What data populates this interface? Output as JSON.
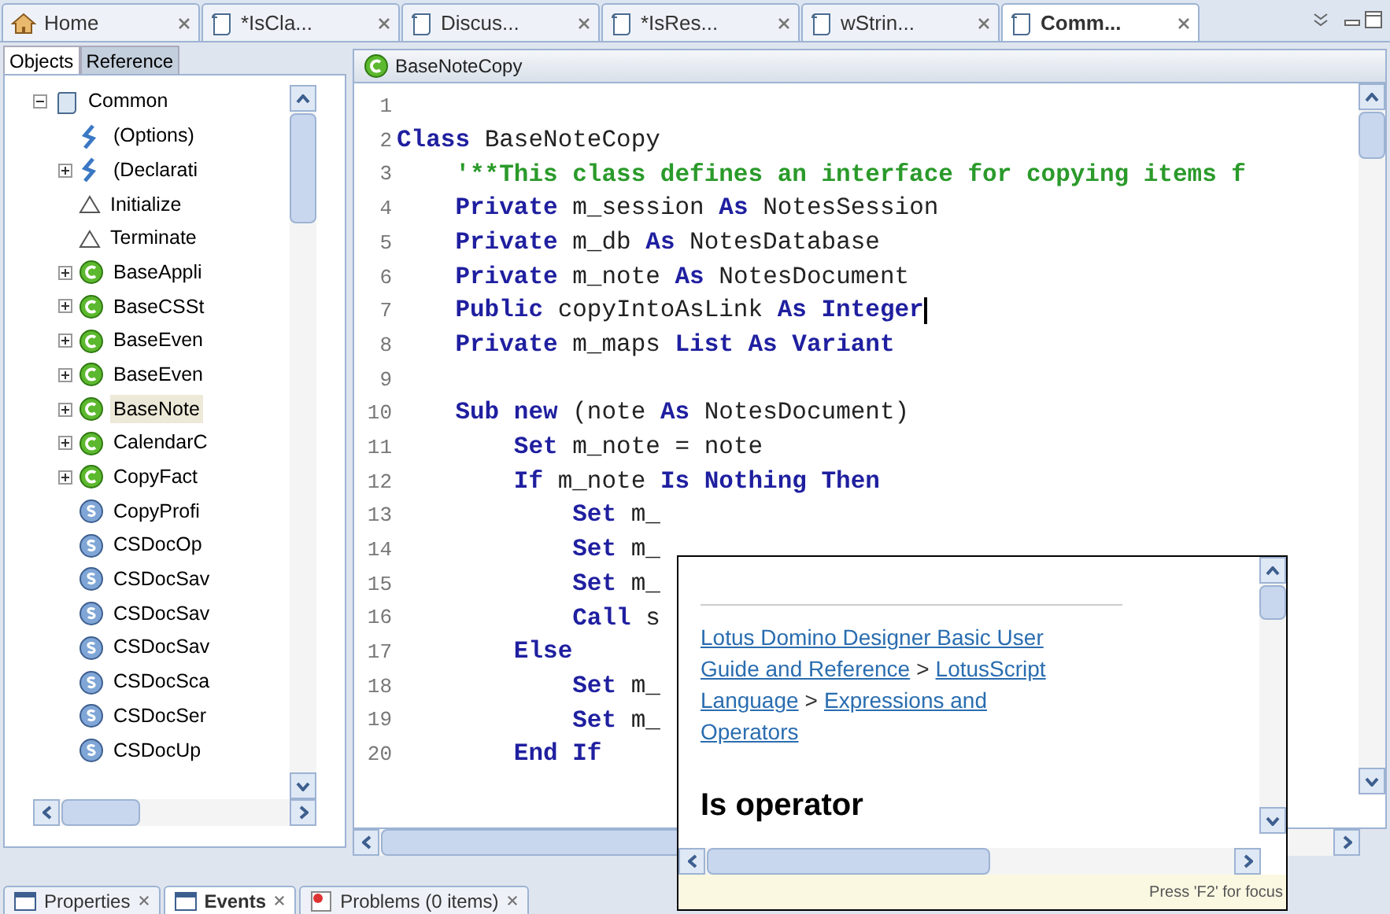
{
  "editor_tabs": [
    {
      "label": "Home",
      "kind": "home",
      "selected": false
    },
    {
      "label": "*IsCla...",
      "kind": "doc",
      "selected": false
    },
    {
      "label": "Discus...",
      "kind": "doc",
      "selected": false
    },
    {
      "label": "*IsRes...",
      "kind": "doc",
      "selected": false
    },
    {
      "label": "wStrin...",
      "kind": "doc",
      "selected": false
    },
    {
      "label": "Comm...",
      "kind": "doc",
      "selected": true
    }
  ],
  "side_tabs": [
    {
      "label": "Objects",
      "selected": true
    },
    {
      "label": "Reference",
      "selected": false
    }
  ],
  "tree": [
    {
      "label": "Common",
      "kind": "library",
      "expanded": true,
      "selected": false,
      "children": [
        {
          "label": "(Options)",
          "kind": "script",
          "selected": false
        },
        {
          "label": "(Declarati",
          "kind": "script",
          "expanded": false,
          "selected": false
        },
        {
          "label": "Initialize",
          "kind": "event",
          "selected": false
        },
        {
          "label": "Terminate",
          "kind": "event",
          "selected": false
        },
        {
          "label": "BaseAppli",
          "kind": "class",
          "expanded": false,
          "selected": false
        },
        {
          "label": "BaseCSSt",
          "kind": "class",
          "expanded": false,
          "selected": false
        },
        {
          "label": "BaseEven",
          "kind": "class",
          "expanded": false,
          "selected": false
        },
        {
          "label": "BaseEven",
          "kind": "class",
          "expanded": false,
          "selected": false
        },
        {
          "label": "BaseNote",
          "kind": "class",
          "expanded": false,
          "selected": true
        },
        {
          "label": "CalendarC",
          "kind": "class",
          "expanded": false,
          "selected": false
        },
        {
          "label": "CopyFact",
          "kind": "class",
          "expanded": false,
          "selected": false
        },
        {
          "label": "CopyProfi",
          "kind": "sub",
          "selected": false
        },
        {
          "label": "CSDocOp",
          "kind": "sub",
          "selected": false
        },
        {
          "label": "CSDocSav",
          "kind": "sub",
          "selected": false
        },
        {
          "label": "CSDocSav",
          "kind": "sub",
          "selected": false
        },
        {
          "label": "CSDocSav",
          "kind": "sub",
          "selected": false
        },
        {
          "label": "CSDocSca",
          "kind": "sub",
          "selected": false
        },
        {
          "label": "CSDocSer",
          "kind": "sub",
          "selected": false
        },
        {
          "label": "CSDocUp",
          "kind": "sub",
          "selected": false
        }
      ]
    }
  ],
  "editor": {
    "title": "BaseNoteCopy",
    "lines": [
      {
        "number": "1"
      },
      {
        "number": "2",
        "tokens": [
          {
            "text": "Class",
            "kind": "keyword"
          },
          {
            "text": " BaseNoteCopy",
            "kind": "plain"
          }
        ]
      },
      {
        "number": "3",
        "tokens": [
          {
            "text": "    '**This class defines an interface for copying items f",
            "kind": "comment"
          }
        ]
      },
      {
        "number": "4",
        "tokens": [
          {
            "text": "    Private",
            "kind": "keyword"
          },
          {
            "text": " m_session ",
            "kind": "plain"
          },
          {
            "text": "As",
            "kind": "keyword"
          },
          {
            "text": " NotesSession",
            "kind": "plain"
          }
        ]
      },
      {
        "number": "5",
        "tokens": [
          {
            "text": "    Private",
            "kind": "keyword"
          },
          {
            "text": " m_db ",
            "kind": "plain"
          },
          {
            "text": "As",
            "kind": "keyword"
          },
          {
            "text": " NotesDatabase",
            "kind": "plain"
          }
        ]
      },
      {
        "number": "6",
        "tokens": [
          {
            "text": "    Private",
            "kind": "keyword"
          },
          {
            "text": " m_note ",
            "kind": "plain"
          },
          {
            "text": "As",
            "kind": "keyword"
          },
          {
            "text": " NotesDocument",
            "kind": "plain"
          }
        ]
      },
      {
        "number": "7",
        "tokens": [
          {
            "text": "    Public",
            "kind": "keyword"
          },
          {
            "text": " copyIntoAsLink ",
            "kind": "plain"
          },
          {
            "text": "As Integer",
            "kind": "keyword"
          }
        ],
        "caret": true
      },
      {
        "number": "8",
        "tokens": [
          {
            "text": "    Private",
            "kind": "keyword"
          },
          {
            "text": " m_maps ",
            "kind": "plain"
          },
          {
            "text": "List As Variant",
            "kind": "keyword"
          }
        ]
      },
      {
        "number": "9"
      },
      {
        "number": "10",
        "tokens": [
          {
            "text": "    Sub new",
            "kind": "keyword"
          },
          {
            "text": " (note ",
            "kind": "plain"
          },
          {
            "text": "As",
            "kind": "keyword"
          },
          {
            "text": " NotesDocument)",
            "kind": "plain"
          }
        ]
      },
      {
        "number": "11",
        "tokens": [
          {
            "text": "        Set",
            "kind": "keyword"
          },
          {
            "text": " m_note = note",
            "kind": "plain"
          }
        ]
      },
      {
        "number": "12",
        "tokens": [
          {
            "text": "        If",
            "kind": "keyword"
          },
          {
            "text": " m_note ",
            "kind": "plain"
          },
          {
            "text": "Is Nothing Then",
            "kind": "keyword"
          }
        ]
      },
      {
        "number": "13",
        "tokens": [
          {
            "text": "            Set",
            "kind": "keyword"
          },
          {
            "text": " m_",
            "kind": "plain"
          }
        ]
      },
      {
        "number": "14",
        "tokens": [
          {
            "text": "            Set",
            "kind": "keyword"
          },
          {
            "text": " m_",
            "kind": "plain"
          }
        ]
      },
      {
        "number": "15",
        "tokens": [
          {
            "text": "            Set",
            "kind": "keyword"
          },
          {
            "text": " m_",
            "kind": "plain"
          }
        ]
      },
      {
        "number": "16",
        "tokens": [
          {
            "text": "            Call",
            "kind": "keyword"
          },
          {
            "text": " s",
            "kind": "plain"
          }
        ]
      },
      {
        "number": "17",
        "tokens": [
          {
            "text": "        Else",
            "kind": "keyword"
          }
        ]
      },
      {
        "number": "18",
        "tokens": [
          {
            "text": "            Set",
            "kind": "keyword"
          },
          {
            "text": " m_",
            "kind": "plain"
          }
        ]
      },
      {
        "number": "19",
        "tokens": [
          {
            "text": "            Set",
            "kind": "keyword"
          },
          {
            "text": " m_",
            "kind": "plain"
          }
        ]
      },
      {
        "number": "20",
        "tokens": [
          {
            "text": "        End If",
            "kind": "keyword"
          }
        ]
      }
    ]
  },
  "help_popup": {
    "breadcrumb_lines": [
      [
        {
          "text": "Lotus Domino Designer Basic User",
          "kind": "link"
        }
      ],
      [
        {
          "text": "Guide and Reference",
          "kind": "link"
        },
        {
          "text": ">",
          "kind": "plain"
        },
        {
          "text": "LotusScript",
          "kind": "link"
        }
      ],
      [
        {
          "text": "Language",
          "kind": "link"
        },
        {
          "text": ">",
          "kind": "plain"
        },
        {
          "text": "Expressions and",
          "kind": "link"
        }
      ],
      [
        {
          "text": "Operators",
          "kind": "link"
        }
      ]
    ],
    "heading": "Is operator",
    "footer": "Press 'F2' for focus"
  },
  "bottom_tabs": [
    {
      "label": "Properties",
      "kind": "properties",
      "selected": false
    },
    {
      "label": "Events",
      "kind": "events",
      "selected": true
    },
    {
      "label": "Problems (0 items)",
      "kind": "problems",
      "selected": false
    }
  ]
}
